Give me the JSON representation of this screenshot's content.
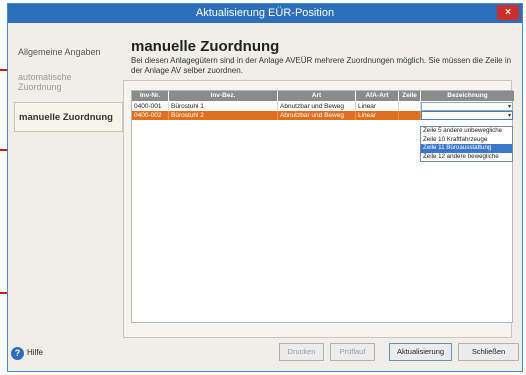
{
  "window": {
    "title": "Aktualisierung EÜR-Position",
    "close_label": "×"
  },
  "nav": {
    "items": [
      {
        "label": "Allgemeine Angaben"
      },
      {
        "label": "automatische\nZuordnung"
      },
      {
        "label": "manuelle Zuordnung"
      }
    ]
  },
  "header": {
    "title": "manuelle Zuordnung",
    "description": "Bei diesen Anlagegütern sind in der Anlage AVEÜR mehrere Zuordnungen möglich. Sie müssen die Zeile in der Anlage AV selber zuordnen."
  },
  "table": {
    "columns": [
      "Inv-Nr.",
      "Inv-Bez.",
      "Art",
      "AfA-Art",
      "Zeile",
      "Bezeichnung"
    ],
    "rows": [
      {
        "inv_nr": "0400-001",
        "inv_bez": "Bürostuhl 1",
        "art": "Abnutzbar und Beweg",
        "afa_art": "Linear",
        "zeile": "",
        "bezeichnung": ""
      },
      {
        "inv_nr": "0400-002",
        "inv_bez": "Bürostuhl 2",
        "art": "Abnutzbar und Beweg",
        "afa_art": "Linear",
        "zeile": "",
        "bezeichnung": ""
      }
    ]
  },
  "dropdown": {
    "options": [
      "Zeile 5 andere unbewegliche",
      "Zeile 10 Kraftfahrzeuge",
      "Zeile 11 Büroausstattung",
      "Zeile 12 andere bewegliche"
    ],
    "highlighted_index": 2
  },
  "footer": {
    "help_label": "Hilfe",
    "print_label": "Drucken",
    "check_label": "Prüflauf",
    "update_label": "Aktualisierung",
    "close_label": "Schließen"
  },
  "colors": {
    "title_bar": "#2b6fb8",
    "selected_row": "#e0701f",
    "callout": "#cc1a1a"
  }
}
